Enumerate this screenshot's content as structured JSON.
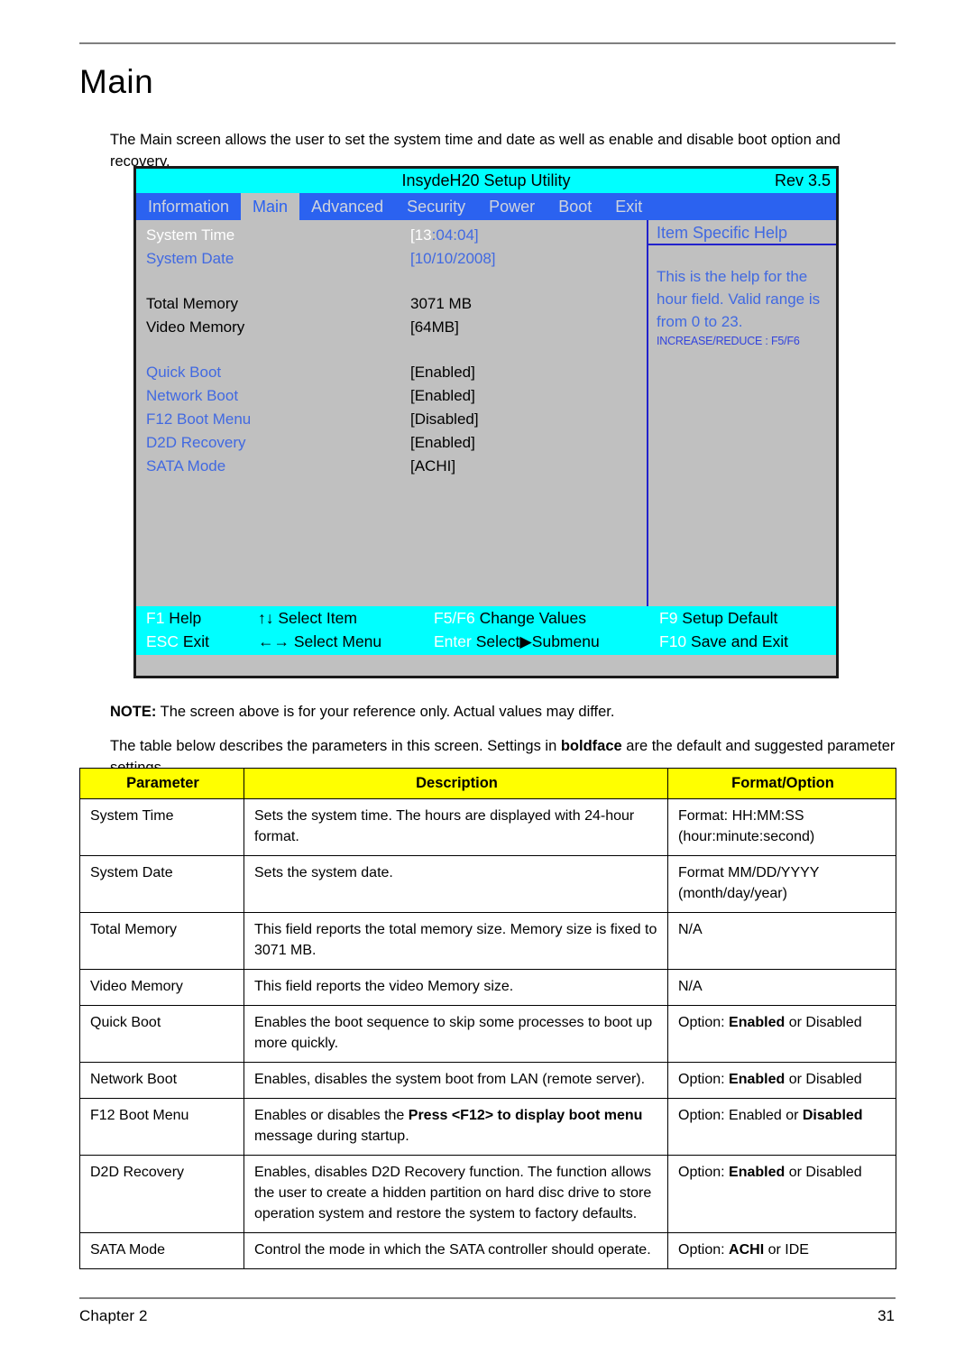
{
  "page": {
    "title": "Main",
    "intro": "The Main screen allows the user to set the system time and date as well as enable and disable boot option and recovery.",
    "note_label": "NOTE:",
    "note_text": " The screen above is for your reference only. Actual values may differ.",
    "table_intro_a": "The table below describes the parameters in this screen. Settings in ",
    "table_intro_bold": "boldface",
    "table_intro_b": " are the default and suggested parameter settings.",
    "footer_left": "Chapter 2",
    "footer_right": "31"
  },
  "bios": {
    "title": "InsydeH20 Setup Utility",
    "revision": "Rev 3.5",
    "menu": [
      {
        "label": "Information",
        "active": false
      },
      {
        "label": "Main",
        "active": true
      },
      {
        "label": "Advanced",
        "active": false
      },
      {
        "label": "Security",
        "active": false
      },
      {
        "label": "Power",
        "active": false
      },
      {
        "label": "Boot",
        "active": false
      },
      {
        "label": "Exit",
        "active": false
      }
    ],
    "settings": [
      {
        "label": "System Time",
        "value_a": "[13",
        "value_b": ":04:04]",
        "label_color": "white",
        "value_a_color": "white",
        "value_b_color": "blue"
      },
      {
        "label": "System Date",
        "value_a": "[10/10/2008]",
        "value_b": "",
        "label_color": "blue",
        "value_a_color": "blue",
        "value_b_color": "blue"
      },
      {
        "label": "Total Memory",
        "value_a": "3071 MB",
        "value_b": "",
        "label_color": "black",
        "value_a_color": "black",
        "value_b_color": "black"
      },
      {
        "label": "Video Memory",
        "value_a": "[64MB]",
        "value_b": "",
        "label_color": "black",
        "value_a_color": "black",
        "value_b_color": "black"
      },
      {
        "label": "Quick Boot",
        "value_a": "[Enabled]",
        "value_b": "",
        "label_color": "blue",
        "value_a_color": "black",
        "value_b_color": "black"
      },
      {
        "label": "Network Boot",
        "value_a": "[Enabled]",
        "value_b": "",
        "label_color": "blue",
        "value_a_color": "black",
        "value_b_color": "black"
      },
      {
        "label": "F12 Boot Menu",
        "value_a": "[Disabled]",
        "value_b": "",
        "label_color": "blue",
        "value_a_color": "black",
        "value_b_color": "black"
      },
      {
        "label": "D2D Recovery",
        "value_a": "[Enabled]",
        "value_b": "",
        "label_color": "blue",
        "value_a_color": "black",
        "value_b_color": "black"
      },
      {
        "label": "SATA Mode",
        "value_a": "[ACHI]",
        "value_b": "",
        "label_color": "blue",
        "value_a_color": "black",
        "value_b_color": "black"
      }
    ],
    "help": {
      "title": "Item Specific Help",
      "text": "This is the help for the hour field. Valid range is from 0 to 23.",
      "note": "INCREASE/REDUCE : F5/F6"
    },
    "keybar": [
      {
        "key": "F1",
        "text": " Help"
      },
      {
        "key": "",
        "text": "↑↓ Select Item"
      },
      {
        "key": "F5/F6",
        "text": " Change Values"
      },
      {
        "key": "F9",
        "text": " Setup Default"
      },
      {
        "key": "ESC",
        "text": " Exit"
      },
      {
        "key": "",
        "text": "←→ Select Menu"
      },
      {
        "key": "Enter",
        "text": " Select▶Submenu"
      },
      {
        "key": "F10",
        "text": " Save and Exit"
      }
    ],
    "colors": {
      "title_bar": "#00ffff",
      "menu_bar": "#2b62f0",
      "body": "#c0c0c0",
      "accent_blue": "#4169e1",
      "keybar": "#00ffff"
    }
  },
  "table": {
    "headers": [
      "Parameter",
      "Description",
      "Format/Option"
    ],
    "rows": [
      {
        "parameter": "System Time",
        "description": "Sets the system time. The hours are displayed with 24-hour format.",
        "format": "Format: HH:MM:SS (hour:minute:second)"
      },
      {
        "parameter": "System Date",
        "description": "Sets the system date.",
        "format": "Format MM/DD/YYYY (month/day/year)"
      },
      {
        "parameter": "Total Memory",
        "description": "This field reports the total memory size. Memory size is fixed to 3071 MB.",
        "format": "N/A"
      },
      {
        "parameter": "Video Memory",
        "description": "This field reports the video Memory size.",
        "format": "N/A"
      },
      {
        "parameter": "Quick Boot",
        "description_parts": [
          {
            "text": "Enables the boot sequence to skip some processes to boot up more quickly.",
            "bold": false
          }
        ],
        "format_parts": [
          {
            "text": "Option: ",
            "bold": false
          },
          {
            "text": "Enabled",
            "bold": true
          },
          {
            "text": " or Disabled",
            "bold": false
          }
        ]
      },
      {
        "parameter": "Network Boot",
        "description_parts": [
          {
            "text": "Enables, disables the system boot from LAN (remote server).",
            "bold": false
          }
        ],
        "format_parts": [
          {
            "text": "Option: ",
            "bold": false
          },
          {
            "text": "Enabled",
            "bold": true
          },
          {
            "text": " or Disabled",
            "bold": false
          }
        ]
      },
      {
        "parameter": "F12 Boot Menu",
        "description_parts": [
          {
            "text": "Enables or disables the ",
            "bold": false
          },
          {
            "text": "Press <F12> to display boot menu",
            "bold": true
          },
          {
            "text": " message during startup.",
            "bold": false
          }
        ],
        "format_parts": [
          {
            "text": "Option: Enabled or ",
            "bold": false
          },
          {
            "text": "Disabled",
            "bold": true
          }
        ]
      },
      {
        "parameter": "D2D Recovery",
        "description_parts": [
          {
            "text": "Enables, disables D2D Recovery function. The function allows the user to create a hidden partition on hard disc drive to store operation system and restore the system to factory defaults.",
            "bold": false
          }
        ],
        "format_parts": [
          {
            "text": "Option: ",
            "bold": false
          },
          {
            "text": "Enabled",
            "bold": true
          },
          {
            "text": " or Disabled",
            "bold": false
          }
        ]
      },
      {
        "parameter": "SATA Mode",
        "description_parts": [
          {
            "text": "Control the mode in which the SATA controller should operate.",
            "bold": false
          }
        ],
        "format_parts": [
          {
            "text": "Option: ",
            "bold": false
          },
          {
            "text": "ACHI",
            "bold": true
          },
          {
            "text": " or IDE",
            "bold": false
          }
        ]
      }
    ]
  }
}
